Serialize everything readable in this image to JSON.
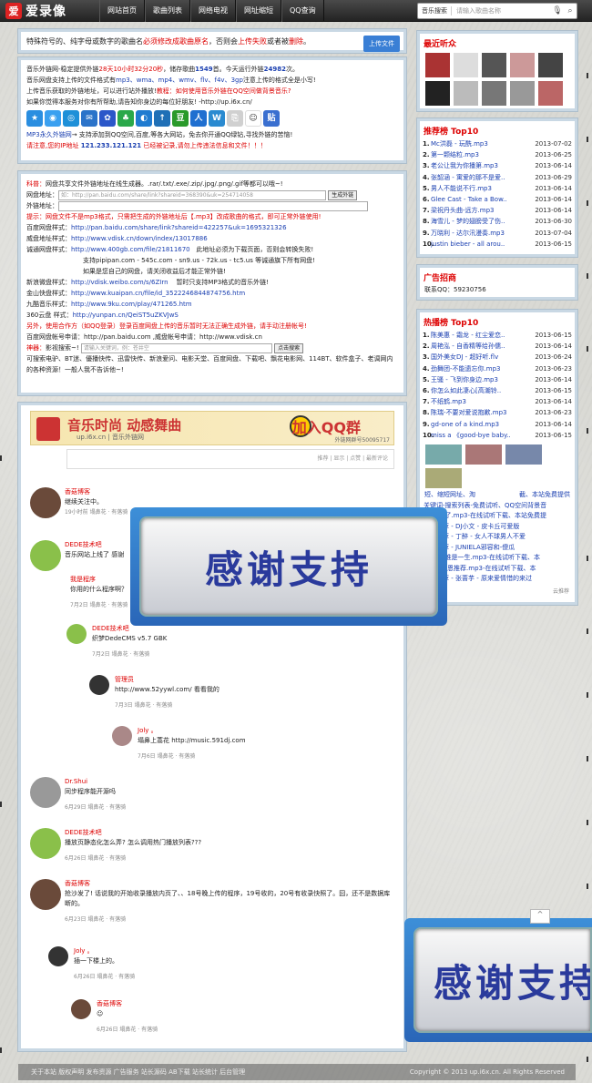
{
  "header": {
    "logo": "爱录像",
    "nav": [
      "网站首页",
      "歌曲列表",
      "网络电视",
      "网址缩短",
      "QQ查询"
    ],
    "search_scope": "音乐搜索",
    "search_placeholder": "请输入歌曲名称"
  },
  "notice": {
    "text_plain": "特殊符号的、纯字母或数字的歌曲名",
    "text_red": "必须修改成歌曲原名",
    "text_tail": "，否则会",
    "text_red2": "上传失败",
    "text_or": "或者被",
    "text_red3": "删除",
    "text_end": "。",
    "upload_btn": "上传文件"
  },
  "info": {
    "l1a": "音乐外链网-稳定提供外链",
    "l1b": "28天10小时32分20秒",
    "l1c": "，储存歌曲",
    "l1d": "1549",
    "l1e": "首。今天运行外链",
    "l1f": "24982",
    "l1g": "次。",
    "l2a": "音乐网盘支持上传的文件格式有",
    "l2b": "mp3、wma、mp4、wmv、flv、f4v、3gp",
    "l2c": "注意上传的格式全是小写!",
    "l3a": "上传音乐获取的外链地址，可以进行站外播放!",
    "l3b": "教程：如何使用音乐外链在QQ空间做背景音乐?",
    "l4": "如果你觉得本服务对你有所帮助,请告知你身边的每位好朋友! -http://up.i6x.cn/",
    "l5a": "MP3永久外链网",
    "l5b": "→ 支持添加到QQ空间,百度,等各大网站，免去你开通QQ绿钻,寻找外链的苦恼!",
    "l6a": "请注意,您的IP地址",
    "l6b": "121.233.121.121",
    "l6c": "已经被记录,请勿上传违法信息和文件！！！"
  },
  "form": {
    "l1a": "科普：",
    "l1b": "网盘共享文件外链地址在线生成器。.rar/.txt/.exe/.zip/.jpg/.png/.gif等都可以哦~!",
    "l2a": "网盘地址：",
    "l2b": "如：http://pan.baidu.com/share/link?shareid=368390&uk=254714058",
    "l2c": "生成外链",
    "l3": "外链地址：",
    "l4": "提示：网盘文件不是mp3格式，只需把生成的外链地址后【.mp3】改成歌曲的格式，即可正常外链使用!",
    "l5a": "百度网盘样式：",
    "l5b": "http://pan.baidu.com/share/link?shareid=422257&uk=1695321326",
    "l6a": "威盘地址样式：",
    "l6b": "http://www.vdisk.cn/down/index/13017886",
    "l7a": "诚通网盘样式：",
    "l7b": "http://www.400gb.com/file/21811670",
    "l7c": "此地址必须为下载页面，否则会转换失败!",
    "l8": "支持pipipan.com - 545c.com - sn9.us - 72k.us - tc5.us 等诚通旗下所有网盘!",
    "l9": "如果是您自己的网盘，请关闭收益后才能正常外链!",
    "l10a": "新浪微盘样式：",
    "l10b": "http://vdisk.weibo.com/s/6ZIrn",
    "l10c": "暂时只支持MP3格式的音乐外链!",
    "l11a": "金山快盘样式：",
    "l11b": "http://www.kuaipan.cn/file/id_3522246844874756.htm",
    "l12a": "九酷音乐样式：",
    "l12b": "http://www.9ku.com/play/471265.htm",
    "l13a": "360云盘 样式：",
    "l13b": "http://yunpan.cn/QeiST5uZKVJwS",
    "l14": "另外，使用合作方（如QQ登录）登录百度网盘上传的音乐暂时无法正确生成外链，请手动注册帐号!",
    "l15": "百度网盘帐号申请：http://pan.baidu.com ,威盘帐号申请：http://www.vdisk.cn",
    "l16a": "神器：",
    "l16b": "影视搜索~!",
    "l16c": "请输入关键词，例：苍井空",
    "l16d": "点击搜索",
    "l17": "可搜索电驴、BT迷、優播快传、迅雷快传、新浪爱问、电影天堂、百度网盘、下载吧、飘花电影网、114BT、软件盒子、老调网内的各种资源！一般人我不告诉他~!"
  },
  "banner": {
    "title": "音乐时尚 动感舞曲",
    "url": "up.i6x.cn | 音乐外链网",
    "join": "加入QQ群",
    "group": "外链网群号50095717"
  },
  "comment_bar": "推荐 | 显示 | 点赞 | 最新评论",
  "comments": [
    {
      "name": "香菇博客",
      "text": "继续关注中。",
      "time": "19小时前",
      "actions": "塌鼻花 · 有落骑"
    },
    {
      "name": "DEDE技术吧",
      "text": "音乐网站上线了 感谢",
      "time": "7月2日",
      "actions": "塌鼻花 · 有落骑"
    },
    {
      "name": "我是程序",
      "text": "你用的什么程序啊？",
      "time": "7月2日",
      "actions": "塌鼻花 · 有落骑"
    },
    {
      "name": "DEDE技术吧",
      "text": "织梦DedeCMS v5.7 GBK",
      "time": "7月2日",
      "actions": "塌鼻花 · 有落骑"
    },
    {
      "name": "管理员",
      "text": "http://www.52yywl.com/ 看看我的",
      "time": "7月3日",
      "actions": "塌鼻花 · 有落骑"
    },
    {
      "name": "Joly 。",
      "text": "塌鼻上蒿花 http://music.591dj.com",
      "time": "7月6日",
      "actions": "塌鼻花 · 有落骑"
    },
    {
      "name": "Dr.Shui",
      "text": "同步程序能开源吗",
      "time": "6月29日",
      "actions": "塌鼻花 · 有落骑"
    },
    {
      "name": "DEDE技术吧",
      "text": "播放页静态化怎么弄? 怎么调用热门播放列表???",
      "time": "6月26日",
      "actions": "塌鼻花 · 有落骑"
    },
    {
      "name": "香菇博客",
      "text": "抢沙发了! 话说我的开始收录播放内页了、、18号晚上传的程序，19号收的，20号有收录快照了。囧，还不是数据库断的。",
      "time": "6月23日",
      "actions": "塌鼻花 · 有落骑"
    },
    {
      "name": "Joly 。",
      "text": "插一下楼上的。",
      "time": "6月26日",
      "actions": "塌鼻花 · 有落骑"
    },
    {
      "name": "香菇博客",
      "text": "",
      "time": "6月26日",
      "actions": "塌鼻花 · 有落骑"
    }
  ],
  "sidebar": {
    "recent_title": "最近听众",
    "top10_title": "推荐榜 Top10",
    "top10": [
      {
        "n": "1.",
        "s": "Mc洪磊 - 玩酰.mp3",
        "d": "2013-07-02"
      },
      {
        "n": "2.",
        "s": "第一颗结粒.mp3",
        "d": "2013-06-25"
      },
      {
        "n": "3.",
        "s": "老公让我为你播第.mp3",
        "d": "2013-06-14"
      },
      {
        "n": "4.",
        "s": "张韶涵 - 寓爱的那不是爱..",
        "d": "2013-06-29"
      },
      {
        "n": "5.",
        "s": "男人不能说不行.mp3",
        "d": "2013-06-14"
      },
      {
        "n": "6.",
        "s": "Glee Cast - Take a Bow..",
        "d": "2013-06-14"
      },
      {
        "n": "7.",
        "s": "梁祝丹头曲-远方.mp3",
        "d": "2013-06-14"
      },
      {
        "n": "8.",
        "s": "海雪儿 - 梦的翅膀受了伤..",
        "d": "2013-06-30"
      },
      {
        "n": "9.",
        "s": "万晓利 - 达尔汛漫奏.mp3",
        "d": "2013-07-04"
      },
      {
        "n": "10.",
        "s": "justin bieber - all arou..",
        "d": "2013-06-15"
      }
    ],
    "ad_title": "广告招商",
    "ad_text": "联系QQ：59230756",
    "hot_title": "热播榜 Top10",
    "hot": [
      {
        "n": "1.",
        "s": "陈美惠 - 霜龙 - 红尘爱恋..",
        "d": "2013-06-15"
      },
      {
        "n": "2.",
        "s": "周艳泓 - 自香精等给孙儒..",
        "d": "2013-06-14"
      },
      {
        "n": "3.",
        "s": "国外美女DJ - 超好听.flv",
        "d": "2013-06-24"
      },
      {
        "n": "4.",
        "s": "劲舞团-不能遗忘你.mp3",
        "d": "2013-06-23"
      },
      {
        "n": "5.",
        "s": "王骚 - 飞到你身边.mp3",
        "d": "2013-06-14"
      },
      {
        "n": "6.",
        "s": "你怎么如此凄心[高潮铃..",
        "d": "2013-06-15"
      },
      {
        "n": "7.",
        "s": "不纸鹤.mp3",
        "d": "2013-06-14"
      },
      {
        "n": "8.",
        "s": "陈瑞-不要对爱说抱歉.mp3",
        "d": "2013-06-23"
      },
      {
        "n": "9.",
        "s": "gd-one of a kind.mp3",
        "d": "2013-06-14"
      },
      {
        "n": "10.",
        "s": "miss a 《good-bye baby..",
        "d": "2013-06-15"
      }
    ],
    "tags": [
      "短、缩短网址、淘",
      "截、本站免费提供"
    ],
    "links": [
      "关键词-搜索列表-免费试听、QQ空间背景音",
      "歌曲-认了.mp3-在线试听下载、本站免费提",
      "单曲推荐 - DJ小文 - 皮卡丘可爱版",
      "单曲推荐 - 丁醉 - 女人不球男人不爱",
      "单曲推荐 - JUNIELA邪容和-傻瓜",
      "歌曲-别谁是一生.mp3-在线试听下载、本",
      "歌曲-零-恩推荐.mp3-在线试听下载、本",
      "单曲推荐 - 张蔷芋 - 原来爱情惜的来过"
    ],
    "more": "云推荐"
  },
  "popup": {
    "text": "感谢支持"
  },
  "footer": {
    "links": "关于本站 版权声明 发布资源 广告服务 站长源码 AB下载 站长统计 后台管理",
    "copyright": "Copyright © 2013  up.i6x.cn. All Rights Reserved"
  }
}
